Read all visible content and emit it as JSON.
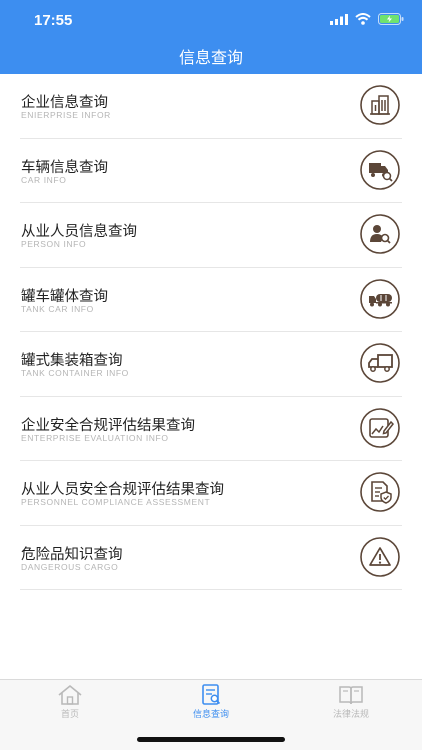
{
  "status_bar": {
    "time": "17:55"
  },
  "header": {
    "title": "信息查询"
  },
  "items": [
    {
      "title": "企业信息查询",
      "subtitle": "ENIERPRISE INFOR",
      "icon": "building-icon"
    },
    {
      "title": "车辆信息查询",
      "subtitle": "CAR INFO",
      "icon": "truck-search-icon"
    },
    {
      "title": "从业人员信息查询",
      "subtitle": "PERSON INFO",
      "icon": "person-search-icon"
    },
    {
      "title": "罐车罐体查询",
      "subtitle": "TANK CAR INFO",
      "icon": "tank-truck-icon"
    },
    {
      "title": "罐式集装箱查询",
      "subtitle": "TANK CONTAINER INFO",
      "icon": "container-truck-icon"
    },
    {
      "title": "企业安全合规评估结果查询",
      "subtitle": "ENTERPRISE EVALUATION INFO",
      "icon": "evaluation-edit-icon"
    },
    {
      "title": "从业人员安全合规评估结果查询",
      "subtitle": "PERSONNEL COMPLIANCE ASSESSMENT",
      "icon": "document-shield-icon"
    },
    {
      "title": "危险品知识查询",
      "subtitle": "DANGEROUS CARGO",
      "icon": "warning-icon"
    }
  ],
  "tabbar": {
    "tabs": [
      {
        "label": "首页",
        "icon": "home-icon",
        "active": false
      },
      {
        "label": "信息查询",
        "icon": "info-query-icon",
        "active": true
      },
      {
        "label": "法律法规",
        "icon": "book-icon",
        "active": false
      }
    ]
  },
  "colors": {
    "primary": "#3d8ef0",
    "icon_brown": "#5b4638",
    "inactive": "#b9b9b9"
  }
}
